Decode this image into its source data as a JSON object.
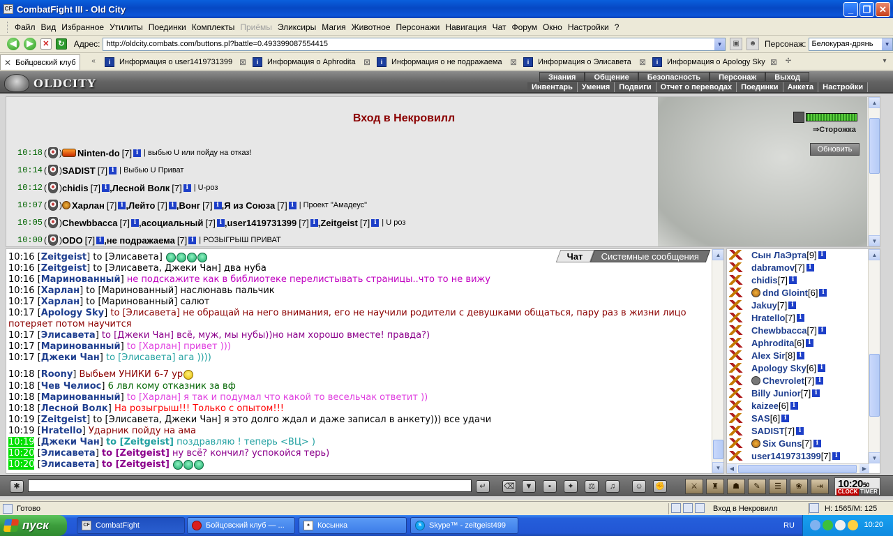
{
  "window": {
    "title": "CombatFight III - Old City",
    "icon": "CF"
  },
  "menu": [
    "Файл",
    "Вид",
    "Избранное",
    "Утилиты",
    "Поединки",
    "Комплекты",
    "Приёмы",
    "Эликсиры",
    "Магия",
    "Животное",
    "Персонажи",
    "Навигация",
    "Чат",
    "Форум",
    "Окно",
    "Настройки",
    "?"
  ],
  "menu_disabled": "Приёмы",
  "address": {
    "label": "Адрес:",
    "url": "http://oldcity.combats.com/buttons.pl?battle=0.493399087554415",
    "char_label": "Персонаж:",
    "char_value": "Белокурая-дрянь"
  },
  "tabs": [
    {
      "label": "Бойцовский клуб",
      "active": true
    },
    {
      "label": "Информация о user1419731399"
    },
    {
      "label": "Информация о Aphrodita"
    },
    {
      "label": "Информация о не подражаема"
    },
    {
      "label": "Информация о Элисавета"
    },
    {
      "label": "Информация о Apology Sky"
    }
  ],
  "site": {
    "logo": "OLDCITY",
    "topnav": [
      "Знания",
      "Общение",
      "Безопасность",
      "Персонаж",
      "Выход"
    ],
    "subnav": [
      "Инвентарь",
      "Умения",
      "Подвиги",
      "Отчет о переводах",
      "Поединки",
      "Анкета",
      "Настройки"
    ]
  },
  "battle": {
    "title": "Вход в Некровилл",
    "watch_link": "⇒Сторожка",
    "refresh_button": "Обновить",
    "rows": [
      {
        "time": "10:18",
        "players": [
          {
            "name": "Ninten-do",
            "lvl": "[7]"
          }
        ],
        "note": "| выбью U или пойду на отказ!"
      },
      {
        "time": "10:14",
        "players": [
          {
            "name": "SADIST",
            "lvl": "[7]"
          }
        ],
        "note": "| Выбью U Приват"
      },
      {
        "time": "10:12",
        "players": [
          {
            "name": "chidis",
            "lvl": "[7]"
          },
          {
            "name": "Лесной Волк",
            "lvl": "[7]"
          }
        ],
        "note": "| U-роз"
      },
      {
        "time": "10:07",
        "players": [
          {
            "name": "Харлан",
            "lvl": "[7]"
          },
          {
            "name": "Лейто",
            "lvl": "[7]"
          },
          {
            "name": "Вонг",
            "lvl": "[7]"
          },
          {
            "name": "Я из Союза",
            "lvl": "[7]"
          }
        ],
        "note": "| Проект \"Амадеус\""
      },
      {
        "time": "10:05",
        "players": [
          {
            "name": "Chewbbacca",
            "lvl": "[7]"
          },
          {
            "name": "асоциальный",
            "lvl": "[7]"
          },
          {
            "name": "user1419731399",
            "lvl": "[7]"
          },
          {
            "name": "Zeitgeist",
            "lvl": "[7]"
          }
        ],
        "note": "| U роз"
      },
      {
        "time": "10:00",
        "players": [
          {
            "name": "ODO",
            "lvl": "[7]"
          },
          {
            "name": "не подражаема",
            "lvl": "[7]"
          }
        ],
        "note": "| РОЗЫГРЫШ ПРИВАТ"
      }
    ]
  },
  "chat": {
    "tab_chat": "Чат",
    "tab_system": "Системные сообщения",
    "lines": [
      {
        "time": "10:16",
        "name": "Zeitgeist",
        "to": "to [Элисавета]",
        "msg": "",
        "color": "#000",
        "emo": 4
      },
      {
        "time": "10:16",
        "name": "Zeitgeist",
        "to": "to [Элисавета, Джеки Чан]",
        "msg": "два нуба",
        "color": "#000"
      },
      {
        "time": "10:16",
        "name": "Маринованный",
        "to": "",
        "msg": "не подскажите как в библиотеке перелистывать страницы..что то не вижу",
        "color": "#c000c0"
      },
      {
        "time": "10:16",
        "name": "Харлан",
        "to": "to [Маринованный]",
        "msg": "наслюнавь пальчик",
        "color": "#000"
      },
      {
        "time": "10:17",
        "name": "Харлан",
        "to": "to [Маринованный]",
        "msg": "салют",
        "color": "#000"
      },
      {
        "time": "10:17",
        "name": "Apology Sky",
        "to": "to [Элисавета]",
        "msg": "не обращай на него внимания, его не научили родители с девушками общаться, пару раз в жизни лицо потеряет потом научится",
        "color": "#8b0000"
      },
      {
        "time": "10:17",
        "name": "Элисавета",
        "to": "to [Джеки Чан]",
        "msg": "всё, муж, мы нубы))но нам хорошо вместе! правда?)",
        "color": "#8b008b"
      },
      {
        "time": "10:17",
        "name": "Маринованный",
        "to": "to [Харлан]",
        "msg": "привет )))",
        "color": "#e040e0"
      },
      {
        "time": "10:17",
        "name": "Джеки Чан",
        "to": "to [Элисавета]",
        "msg": "ага ))))",
        "color": "#20a0a0"
      },
      {
        "time": "10:18",
        "name": "Roony",
        "to": "",
        "msg": "Выбьем УНИКИ 6-7 ур",
        "color": "#8b0000",
        "emo": 1,
        "emo_y": true
      },
      {
        "time": "10:18",
        "name": "Чев Челиос",
        "to": "",
        "msg": "6 лвл кому отказник за вф",
        "color": "#006400"
      },
      {
        "time": "10:18",
        "name": "Маринованный",
        "to": "to [Харлан]",
        "msg": "я так и подумал что какой то весельчак ответит ))",
        "color": "#e040e0"
      },
      {
        "time": "10:18",
        "name": "Лесной Волк",
        "to": "",
        "msg": "На розыгрыш!!! Только с опытом!!!",
        "color": "#ff0000"
      },
      {
        "time": "10:19",
        "name": "Zeitgeist",
        "to": "to [Элисавета, Джеки Чан]",
        "msg": "я это долго ждал и даже записал в анкету))) все удачи",
        "color": "#000"
      },
      {
        "time": "10:19",
        "name": "Hratello",
        "to": "",
        "msg": "Ударник пойду на ама",
        "color": "#8b0000"
      },
      {
        "time": "10:19",
        "name": "Джеки Чан",
        "to": "to [Zeitgeist]",
        "msg": "поздравляю ! теперь <ВЦ> )",
        "color": "#20a0a0",
        "hl": true,
        "bold_to": true
      },
      {
        "time": "10:20",
        "name": "Элисавета",
        "to": "to [Zeitgeist]",
        "msg": "ну всё? кончил? успокойся терь)",
        "color": "#8b008b",
        "hl": true,
        "bold_to": true
      },
      {
        "time": "10:20",
        "name": "Элисавета",
        "to": "to [Zeitgeist]",
        "msg": "",
        "color": "#8b008b",
        "hl": true,
        "bold_to": true,
        "emo": 3
      }
    ]
  },
  "users": [
    {
      "name": "Сын ЛаЭрта",
      "lvl": "[9]"
    },
    {
      "name": "dabramov",
      "lvl": "[7]"
    },
    {
      "name": "chidis",
      "lvl": "[7]"
    },
    {
      "name": "dnd Gloint",
      "lvl": "[6]",
      "extra": true
    },
    {
      "name": "Jakuy",
      "lvl": "[7]"
    },
    {
      "name": "Hratello",
      "lvl": "[7]"
    },
    {
      "name": "Chewbbacca",
      "lvl": "[7]"
    },
    {
      "name": "Aphrodita",
      "lvl": "[6]"
    },
    {
      "name": "Alex Sir",
      "lvl": "[8]"
    },
    {
      "name": "Apology Sky",
      "lvl": "[6]"
    },
    {
      "name": "Chevrolet",
      "lvl": "[7]",
      "extra": true
    },
    {
      "name": "Billy Junior",
      "lvl": "[7]"
    },
    {
      "name": "kaizee",
      "lvl": "[6]"
    },
    {
      "name": "SAS",
      "lvl": "[6]"
    },
    {
      "name": "SADIST",
      "lvl": "[7]"
    },
    {
      "name": "Six Guns",
      "lvl": "[7]",
      "extra": true
    },
    {
      "name": "user1419731399",
      "lvl": "[7]"
    }
  ],
  "clock": {
    "time": "10:20",
    "seconds": "50",
    "clock_label": "CLOCK",
    "timer_label": "TIMER"
  },
  "status": {
    "left": "Готово",
    "location": "Вход в Некровилл",
    "hp": "H: 1565/M: 125"
  },
  "taskbar": {
    "start": "пуск",
    "tasks": [
      "CombatFight",
      "Бойцовский клуб — ...",
      "Косынка",
      "Skype™ - zeitgeist499"
    ],
    "lang": "RU",
    "time": "10:20"
  },
  "colors": {
    "title_blue": "#0648c4",
    "battle_title": "#8b0000",
    "name_blue": "#1f3f8f",
    "highlight_green": "#00e000"
  }
}
